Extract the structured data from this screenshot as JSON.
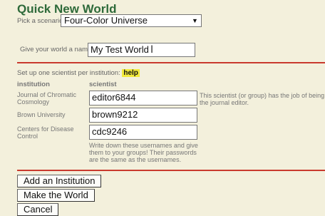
{
  "title": "Quick New World",
  "scenario": {
    "label": "Pick a scenario:",
    "value": "Four-Color Universe"
  },
  "world": {
    "label": "Give your world a name:",
    "value": "My Test World"
  },
  "setup": {
    "text": "Set up one scientist per institution:",
    "help": "help"
  },
  "columns": {
    "institution": "institution",
    "scientist": "scientist"
  },
  "rows": [
    {
      "institution": "Journal of Chromatic Cosmology",
      "scientist": "editor6844",
      "note": "This scientist (or group) has the job of being the journal editor."
    },
    {
      "institution": "Brown University",
      "scientist": "brown9212"
    },
    {
      "institution": "Centers for Disease Control",
      "scientist": "cdc9246"
    }
  ],
  "hint": "Write down these usernames and give them to your groups! Their passwords are the same as the usernames.",
  "buttons": {
    "add": "Add an Institution",
    "make": "Make the World",
    "cancel": "Cancel"
  }
}
